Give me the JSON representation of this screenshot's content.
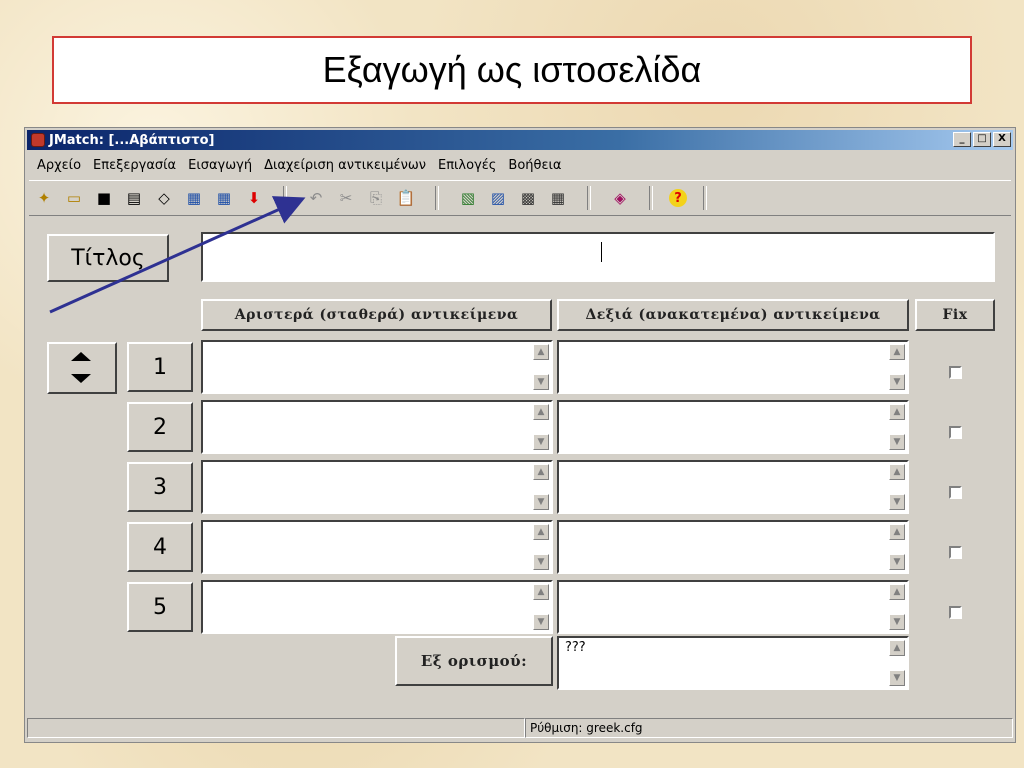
{
  "slide": {
    "title": "Εξαγωγή ως ιστοσελίδα"
  },
  "window": {
    "title": "JMatch: [...Αβάπτιστο]",
    "buttons": {
      "minimize": "_",
      "maximize": "□",
      "close": "X"
    }
  },
  "menu": [
    "Αρχείο",
    "Επεξεργασία",
    "Εισαγωγή",
    "Διαχείριση αντικειμένων",
    "Επιλογές",
    "Βοήθεια"
  ],
  "toolbar": {
    "icons": [
      "new-icon",
      "open-icon",
      "save-icon",
      "save-as-icon",
      "view-in-browser-icon",
      "export-webpage-icon",
      "export-webpage-2-icon",
      "upload-icon",
      "undo-icon",
      "cut-icon",
      "copy-icon",
      "paste-icon",
      "insert-picture-icon",
      "insert-link-icon",
      "insert-media-icon",
      "shuffle-icon",
      "configure-icon",
      "help-icon"
    ],
    "glyphs": [
      "✦",
      "▭",
      "■",
      "▤",
      "◇",
      "▦",
      "▦",
      "⬇",
      "↶",
      "✂",
      "⎘",
      "📋",
      "▧",
      "▨",
      "▩",
      "▦",
      "◈",
      "?"
    ]
  },
  "form": {
    "title_label": "Τίτλος",
    "title_value": "",
    "headers": {
      "left": "Αριστερά (σταθερά) αντικείμενα",
      "right": "Δεξιά (ανακατεμένα) αντικείμενα",
      "fix": "Fix"
    },
    "rows": [
      {
        "num": "1",
        "left": "",
        "right": "",
        "fixed": false
      },
      {
        "num": "2",
        "left": "",
        "right": "",
        "fixed": false
      },
      {
        "num": "3",
        "left": "",
        "right": "",
        "fixed": false
      },
      {
        "num": "4",
        "left": "",
        "right": "",
        "fixed": false
      },
      {
        "num": "5",
        "left": "",
        "right": "",
        "fixed": false
      }
    ],
    "default_label": "Εξ ορισμού:",
    "default_value": "???"
  },
  "status": {
    "config": "Ρύθμιση: greek.cfg"
  },
  "colors": {
    "frame": "#d23a35",
    "titlebar_start": "#0a246a",
    "arrow": "#2e3192",
    "help": "#e8c400"
  }
}
